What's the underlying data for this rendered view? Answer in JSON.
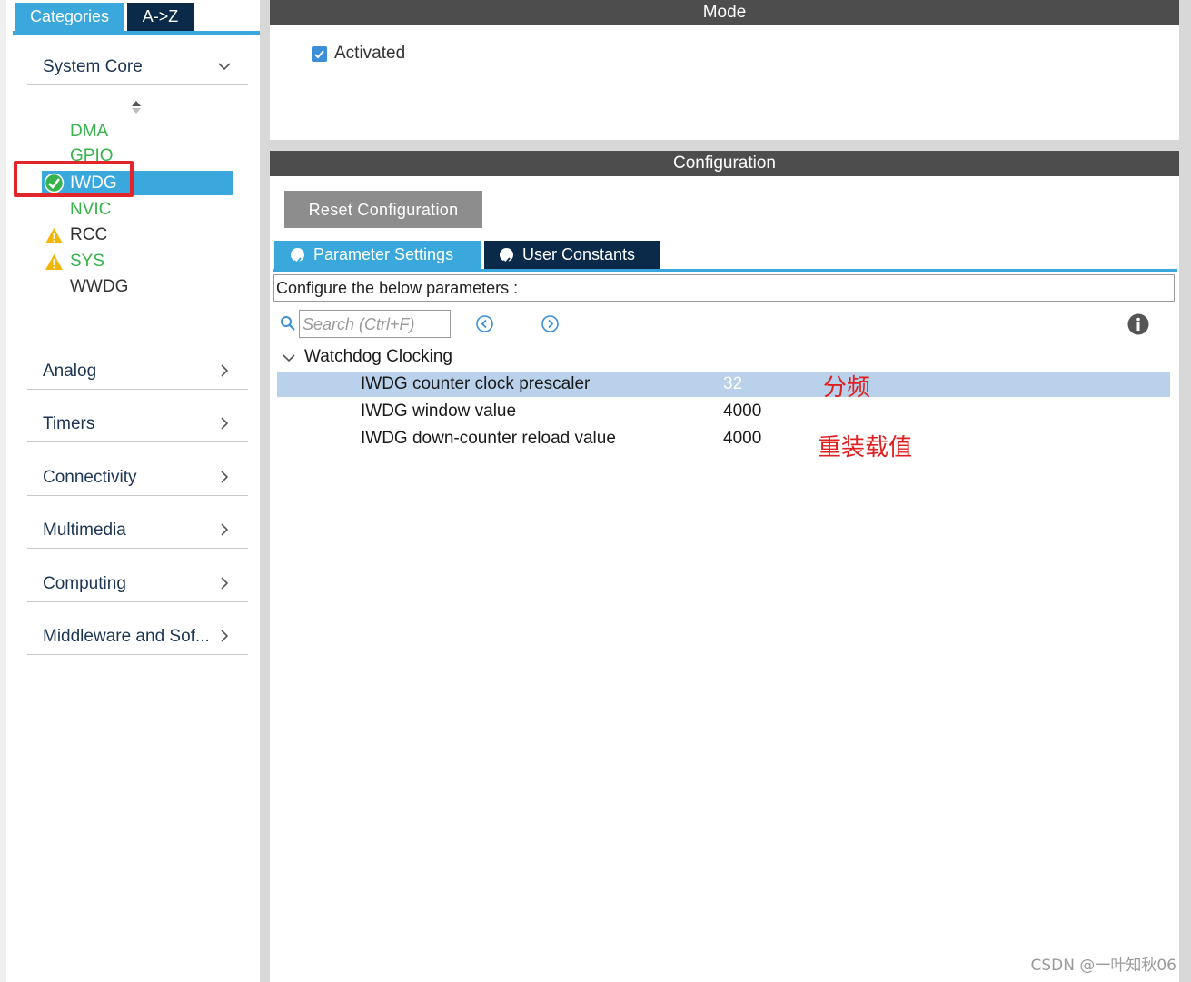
{
  "left_panel": {
    "tabs": [
      "Categories",
      "A->Z"
    ],
    "system_core": {
      "label": "System Core",
      "items": [
        {
          "label": "DMA",
          "status": "none"
        },
        {
          "label": "GPIO",
          "status": "none"
        },
        {
          "label": "IWDG",
          "status": "ok"
        },
        {
          "label": "NVIC",
          "status": "none"
        },
        {
          "label": "RCC",
          "status": "warning"
        },
        {
          "label": "SYS",
          "status": "warning"
        },
        {
          "label": "WWDG",
          "status": "none"
        }
      ]
    },
    "categories": [
      "Analog",
      "Timers",
      "Connectivity",
      "Multimedia",
      "Computing",
      "Middleware and Sof..."
    ]
  },
  "mode": {
    "title": "Mode",
    "activated_label": "Activated",
    "activated": true
  },
  "configuration": {
    "title": "Configuration",
    "reset_label": "Reset Configuration",
    "tabs": [
      "Parameter Settings",
      "User Constants"
    ],
    "hint": "Configure the below parameters :",
    "search_placeholder": "Search (Ctrl+F)",
    "group": "Watchdog Clocking",
    "params": [
      {
        "name": "IWDG counter clock prescaler",
        "value": "32"
      },
      {
        "name": "IWDG window value",
        "value": "4000"
      },
      {
        "name": "IWDG down-counter reload value",
        "value": "4000"
      }
    ]
  },
  "annotations": {
    "prescaler_note": "分频",
    "reload_note": "重装载值"
  },
  "watermark": "CSDN @一叶知秋06",
  "colors": {
    "accent": "#3aa8dd",
    "dark_tab": "#0b2a4a",
    "header_bar": "#4d4d4d",
    "highlight_row": "#b9d1ea",
    "annotation": "#e02020",
    "ok_green": "#36b34a",
    "warning": "#f2b705"
  }
}
